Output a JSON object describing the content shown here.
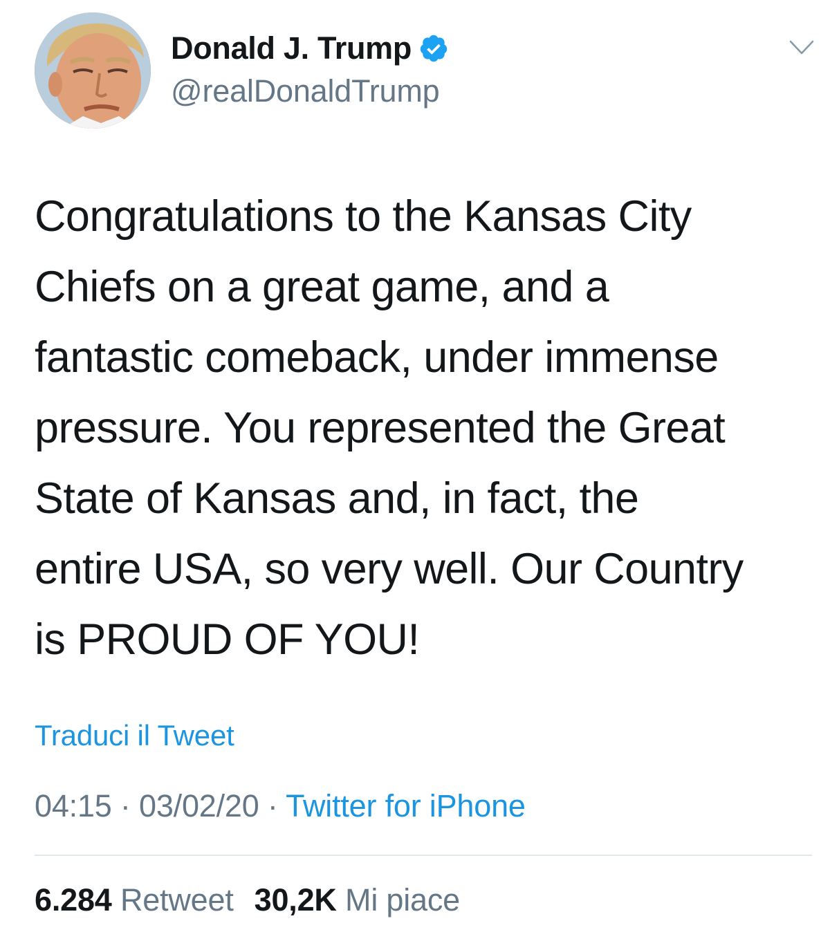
{
  "author": {
    "display_name": "Donald J. Trump",
    "handle": "@realDonaldTrump",
    "verified": true,
    "avatar_icon": "profile-photo"
  },
  "menu": {
    "icon": "chevron-down-icon"
  },
  "tweet": {
    "lines": [
      "Congratulations to the Kansas City",
      "Chiefs on a great game, and a",
      "fantastic comeback, under immense",
      "pressure. You represented the Great",
      "State of Kansas and, in fact, the",
      "entire USA, so very well. Our Country",
      "is PROUD OF YOU!"
    ]
  },
  "translate_label": "Traduci il Tweet",
  "meta": {
    "time": "04:15",
    "separator": " · ",
    "date": "03/02/20",
    "source": "Twitter for iPhone"
  },
  "stats": {
    "retweets_count": "6.284",
    "retweets_label": "Retweet",
    "likes_count": "30,2K",
    "likes_label": "Mi piace"
  },
  "colors": {
    "link_blue": "#1b95e0",
    "secondary_gray": "#657786",
    "text_dark": "#14171a",
    "verified_blue": "#1da1f2",
    "divider": "#e1e8ed"
  }
}
